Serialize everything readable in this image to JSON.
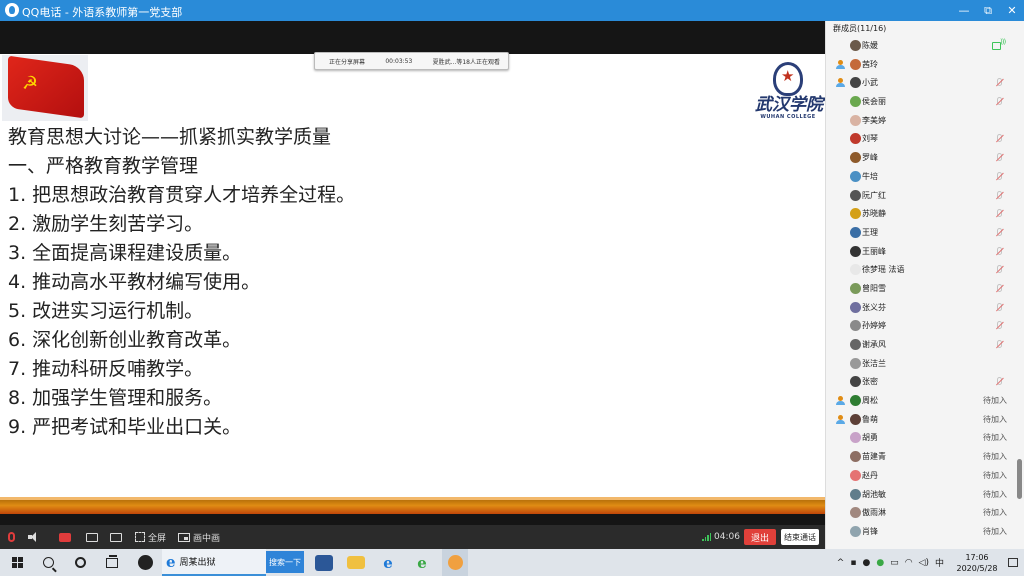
{
  "window": {
    "title": "QQ电话 - 外语系教师第一党支部",
    "controls": [
      "—",
      "⧉",
      "✕"
    ]
  },
  "share_status": {
    "sharing_label": "正在分享屏幕",
    "elapsed": "00:03:53",
    "viewers": "夏胜武...等18人正在观看"
  },
  "slide": {
    "logo_cn": "武汉学院",
    "logo_en": "WUHAN COLLEGE",
    "lines": [
      "教育思想大讨论——抓紧抓实教学质量",
      "一、严格教育教学管理",
      "1. 把思想政治教育贯穿人才培养全过程。",
      "2. 激励学生刻苦学习。",
      "3. 全面提高课程建设质量。",
      "4. 推动高水平教材编写使用。",
      "5. 改进实习运行机制。",
      "6. 深化创新创业教育改革。",
      "7. 推动科研反哺教学。",
      "8. 加强学生管理和服务。",
      "9. 严把考试和毕业出口关。"
    ]
  },
  "toolbar": {
    "fullscreen_label": "全屏",
    "pip_label": "画中画",
    "call_time": "04:06",
    "exit_label": "退出",
    "end_call_label": "结束通话"
  },
  "members": {
    "header": "群成员(11/16)",
    "list": [
      {
        "name": "陈媛",
        "host": false,
        "status": "speaking",
        "avatar": "#6b5a4a"
      },
      {
        "name": "茜玲",
        "host": true,
        "status": "none",
        "avatar": "#c46a3a"
      },
      {
        "name": "小武",
        "host": true,
        "status": "muted",
        "avatar": "#444444"
      },
      {
        "name": "侯会丽",
        "host": false,
        "status": "muted",
        "avatar": "#6aa84f"
      },
      {
        "name": "李美婷",
        "host": false,
        "status": "none",
        "avatar": "#d9b3a3"
      },
      {
        "name": "刘琴",
        "host": false,
        "status": "muted",
        "avatar": "#c0392b"
      },
      {
        "name": "罗峰",
        "host": false,
        "status": "muted",
        "avatar": "#8e5a2a"
      },
      {
        "name": "牛培",
        "host": false,
        "status": "muted",
        "avatar": "#4a90c4"
      },
      {
        "name": "阮广红",
        "host": false,
        "status": "muted",
        "avatar": "#555555"
      },
      {
        "name": "苏晓静",
        "host": false,
        "status": "muted",
        "avatar": "#d4a017"
      },
      {
        "name": "王理",
        "host": false,
        "status": "muted",
        "avatar": "#3a6ea5"
      },
      {
        "name": "王丽峰",
        "host": false,
        "status": "muted",
        "avatar": "#333333"
      },
      {
        "name": "徐梦瑶 法语",
        "host": false,
        "status": "muted",
        "avatar": "#e8e8e8"
      },
      {
        "name": "曾阳雪",
        "host": false,
        "status": "muted",
        "avatar": "#7a9a5a"
      },
      {
        "name": "张义芬",
        "host": false,
        "status": "muted",
        "avatar": "#6f6f9f"
      },
      {
        "name": "孙婷婷",
        "host": false,
        "status": "muted",
        "avatar": "#8a8a8a"
      },
      {
        "name": "谢承风",
        "host": false,
        "status": "muted",
        "avatar": "#666666"
      },
      {
        "name": "张洁兰",
        "host": false,
        "status": "none",
        "avatar": "#999999"
      },
      {
        "name": "张密",
        "host": false,
        "status": "muted",
        "avatar": "#444444"
      },
      {
        "name": "周松",
        "host": true,
        "status": "waiting",
        "avatar": "#2e7d32"
      },
      {
        "name": "鲁萌",
        "host": true,
        "status": "waiting",
        "avatar": "#5d4037"
      },
      {
        "name": "胡勇",
        "host": false,
        "status": "waiting",
        "avatar": "#c8a2c8"
      },
      {
        "name": "苗建青",
        "host": false,
        "status": "waiting",
        "avatar": "#8d6e63"
      },
      {
        "name": "赵丹",
        "host": false,
        "status": "waiting",
        "avatar": "#e57373"
      },
      {
        "name": "胡池敏",
        "host": false,
        "status": "waiting",
        "avatar": "#607d8b"
      },
      {
        "name": "傲雨淋",
        "host": false,
        "status": "waiting",
        "avatar": "#a1887f"
      },
      {
        "name": "肖锋",
        "host": false,
        "status": "waiting",
        "avatar": "#90a4ae"
      }
    ],
    "waiting_label": "待加入"
  },
  "taskbar": {
    "ie_task_label": "周某出狱",
    "search_button": "搜索一下",
    "ime": "中",
    "time": "17:06",
    "date": "2020/5/28"
  },
  "colors": {
    "titlebar": "#2a8bd8",
    "exit": "#e0403a",
    "slide_bar": "#e08c14"
  }
}
